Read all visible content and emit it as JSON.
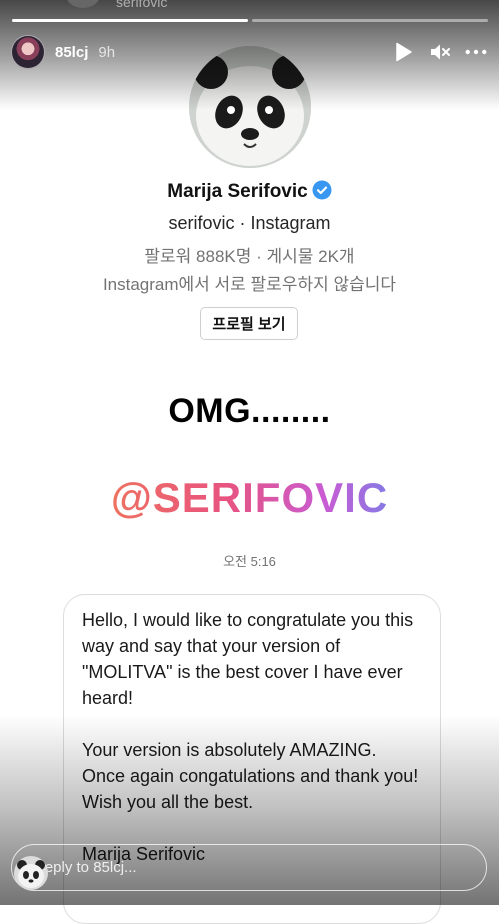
{
  "story": {
    "progress_segments": [
      1.0,
      0.0
    ],
    "peek_text": "serifovic",
    "username": "85lcj",
    "time_ago": "9h"
  },
  "header_icons": [
    "play-icon",
    "mute-icon",
    "more-icon"
  ],
  "profile_card": {
    "name": "Marija Serifovic",
    "handle_line": "serifovic · Instagram",
    "followers_line": "팔로워 888K명 · 게시물 2K개",
    "not_following_line": "Instagram에서 서로 팔로우하지 않습니다",
    "view_profile_button": "프로필 보기"
  },
  "overlay": {
    "omg_text": "OMG........",
    "mention_text": "@SERIFOVIC"
  },
  "message": {
    "timestamp": "오전 5:16",
    "paragraph1": "Hello, I would like to congratulate you this way and say that your version of \"MOLITVA\" is the best cover I have ever heard!",
    "paragraph2": "Your version is absolutely AMAZING. Once again congatulations and thank you! Wish you all the best.",
    "signature": "Marija Serifovic"
  },
  "reply": {
    "placeholder": "Reply to 85lcj..."
  },
  "colors": {
    "verified_badge": "#3897f0",
    "mention_gradient_start": "#f4a14a",
    "mention_gradient_end": "#5aa8f2"
  }
}
